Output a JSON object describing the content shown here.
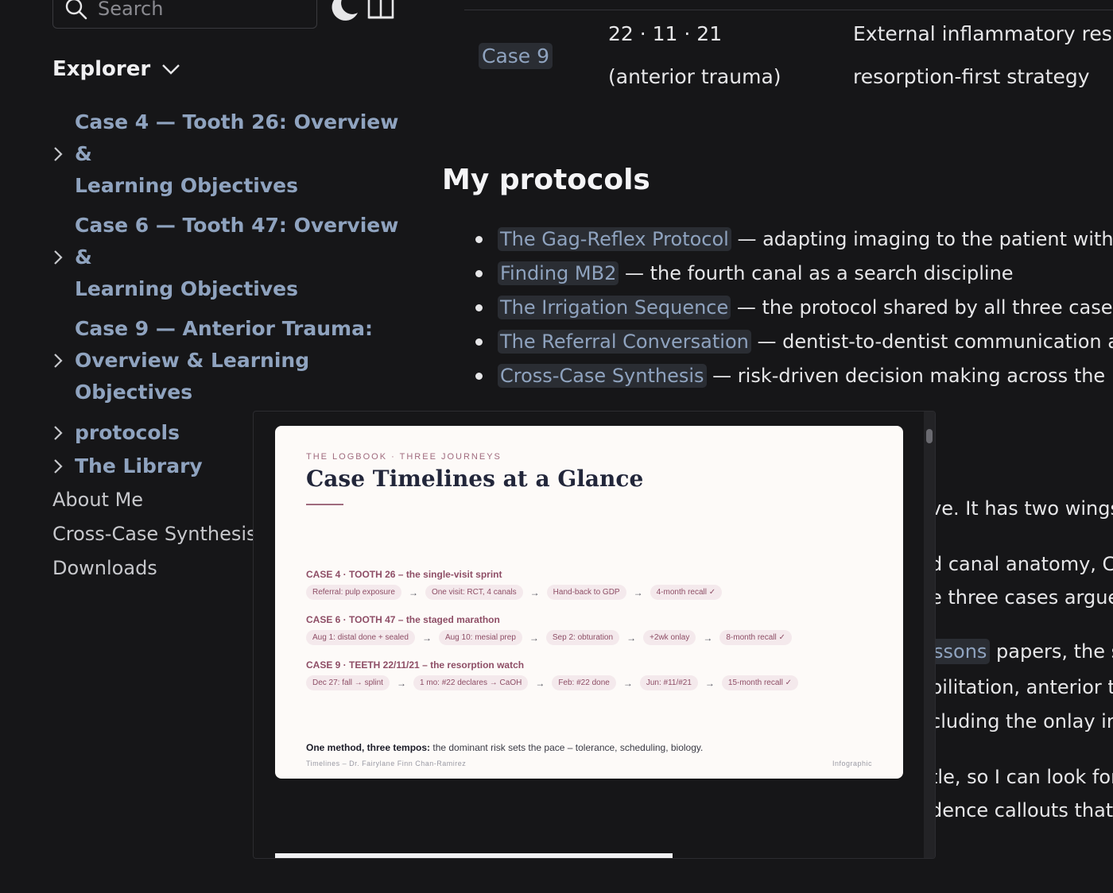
{
  "search": {
    "placeholder": "Search",
    "icon": "search-icon"
  },
  "header_icons": {
    "theme": "moon-icon",
    "reader": "book-icon"
  },
  "explorer": {
    "title": "Explorer",
    "items": [
      {
        "label": "Case 4 — Tooth 26: Overview & Learning Objectives",
        "line1": "Case 4 — Tooth 26: Overview &",
        "line2": "Learning Objectives"
      },
      {
        "label": "Case 6 — Tooth 47: Overview & Learning Objectives",
        "line1": "Case 6 — Tooth 47: Overview &",
        "line2": "Learning Objectives"
      },
      {
        "label": "Case 9 — Anterior Trauma: Overview & Learning Objectives",
        "line1": "Case 9 — Anterior Trauma:",
        "line2": "Overview & Learning Objectives"
      },
      {
        "label": "protocols"
      },
      {
        "label": "The Library"
      }
    ],
    "pages": [
      "About Me",
      "Cross-Case Synthesis",
      "Downloads"
    ]
  },
  "table_row": {
    "case": "Case 9",
    "date_line1": "22 · 11 · 21",
    "date_line2": "(anterior trauma)",
    "desc_line1": "External inflammatory resorp",
    "desc_line2": "resorption-first strategy"
  },
  "protocols": {
    "heading": "My protocols",
    "items": [
      {
        "link": "The Gag-Reflex Protocol",
        "text": " — adapting imaging to the patient without lo"
      },
      {
        "link": "Finding MB2",
        "text": " — the fourth canal as a search discipline"
      },
      {
        "link": "The Irrigation Sequence",
        "text": " — the protocol shared by all three cases"
      },
      {
        "link": "The Referral Conversation",
        "text": " — dentist-to-dentist communication as cli"
      },
      {
        "link": "Cross-Case Synthesis",
        "text": " — risk-driven decision making across the logbo"
      }
    ]
  },
  "background_text": {
    "l1": "ve. It has two wings,",
    "l2": "d canal anatomy, CB",
    "l3": "e three cases argue f",
    "l4_link": "ssons",
    "l4_text": " papers, the st",
    "l5": "bilitation, anterior tec",
    "l6": "cluding the onlay in",
    "l7": "tle, so I can look for",
    "l8": "dence callouts that p"
  },
  "infographic": {
    "eyebrow": "THE LOGBOOK · THREE JOURNEYS",
    "title": "Case Timelines at a Glance",
    "accent_color": "#a06b7e",
    "cases": [
      {
        "heading": "CASE 4 · TOOTH 26 – the single-visit sprint",
        "steps": [
          "Referral: pulp exposure",
          "One visit: RCT, 4 canals",
          "Hand-back to GDP",
          "4-month recall ✓"
        ]
      },
      {
        "heading": "CASE 6 · TOOTH 47 – the staged marathon",
        "steps": [
          "Aug 1: distal done + sealed",
          "Aug 10: mesial prep",
          "Sep 2: obturation",
          "+2wk onlay",
          "8-month recall ✓"
        ]
      },
      {
        "heading": "CASE 9 · TEETH 22/11/21 – the resorption watch",
        "steps": [
          "Dec 27: fall → splint",
          "1 mo: #22 declares → CaOH",
          "Feb: #22 done",
          "Jun: #11/#21",
          "15-month recall ✓"
        ]
      }
    ],
    "arrow": "→",
    "footer_bold": "One method, three tempos:",
    "footer_text": " the dominant risk sets the pace – tolerance, scheduling, biology.",
    "credit": "Timelines – Dr. Fairylane Finn Chan-Ramirez",
    "kind": "Infographic"
  }
}
